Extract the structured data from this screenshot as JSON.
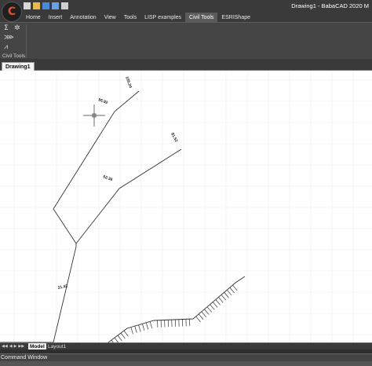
{
  "app": {
    "logo_glyph": "C",
    "window_title": "Drawing1 - BabaCAD 2020 M"
  },
  "quick_access_icons": [
    "new-file-icon",
    "open-folder-icon",
    "save-icon",
    "undo-icon",
    "redo-icon"
  ],
  "ribbon_tabs": [
    {
      "label": "Home",
      "active": false
    },
    {
      "label": "Insert",
      "active": false
    },
    {
      "label": "Annotation",
      "active": false
    },
    {
      "label": "View",
      "active": false
    },
    {
      "label": "Tools",
      "active": false
    },
    {
      "label": "LISP examples",
      "active": false
    },
    {
      "label": "Civil Tools",
      "active": true
    },
    {
      "label": "ESRIShape",
      "active": false
    }
  ],
  "ribbon_panel": {
    "label": "Civil Tools",
    "tools": [
      "sigma-icon",
      "gear-icon",
      "slope-icon",
      "embankment-icon"
    ]
  },
  "document_tab": "Drawing1",
  "drawing": {
    "labels": [
      {
        "text": "105.24"
      },
      {
        "text": "95.92"
      },
      {
        "text": "81.52"
      },
      {
        "text": "62.36"
      },
      {
        "text": "21.42"
      }
    ]
  },
  "layout_tabs": {
    "model": "Model",
    "layout1": "Layout1"
  },
  "command_window": {
    "title": "Command Window"
  },
  "colors": {
    "background_dark": "#2b2b2b",
    "ribbon": "#454545",
    "active_tab": "#5b5b5b",
    "canvas": "#ffffff",
    "grid": "#ececec",
    "line": "#333333"
  }
}
